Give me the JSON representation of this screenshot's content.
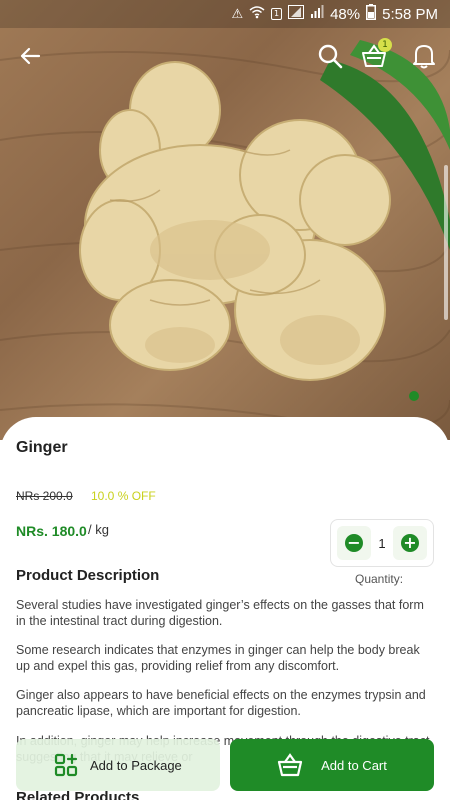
{
  "status_bar": {
    "battery": "48%",
    "time": "5:58 PM",
    "notification_count": "1"
  },
  "header": {
    "cart_badge": "1"
  },
  "product": {
    "name": "Ginger",
    "old_price": "NRs 200.0",
    "discount": "10.0 % OFF",
    "price": "NRs. 180.0",
    "unit": "/ kg"
  },
  "quantity": {
    "value": "1",
    "label": "Quantity:"
  },
  "description": {
    "title": "Product Description",
    "paragraphs": [
      "Several studies have investigated ginger’s effects on the gasses that form in the intestinal tract during digestion.",
      "Some research indicates that enzymes in ginger can help the body break up and expel this gas, providing relief from any discomfort.",
      "Ginger also appears to have beneficial effects on the enzymes trypsin and pancreatic lipase, which are important for digestion.",
      "In addition, ginger may help increase movement through the digestive tract, suggesting that it may relieve or"
    ]
  },
  "related": {
    "title": "Related Products"
  },
  "actions": {
    "add_to_package": "Add to Package",
    "add_to_cart": "Add to Cart"
  },
  "colors": {
    "brand_green": "#1f8b27",
    "discount_yellow": "#c9d11c",
    "package_bg": "#e2f2de"
  }
}
